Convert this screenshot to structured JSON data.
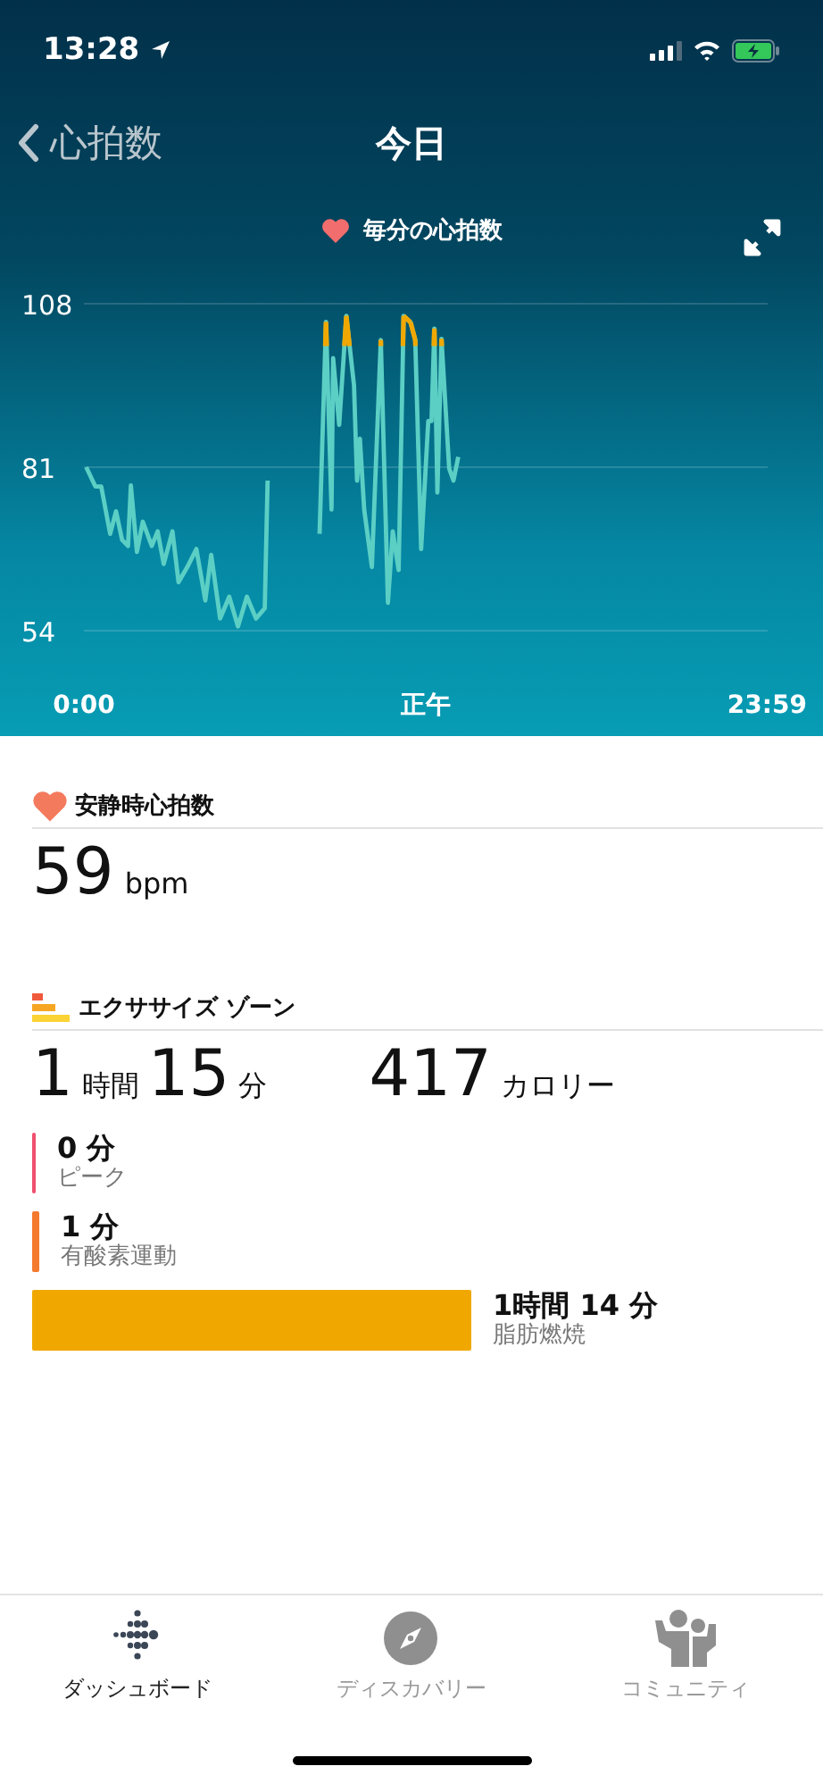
{
  "status_bar": {
    "time": "13:28"
  },
  "nav": {
    "back": "心拍数",
    "title": "今日"
  },
  "chart": {
    "title": "毎分の心拍数",
    "chart_data": {
      "type": "line",
      "x": [
        0.08,
        0.4,
        0.61,
        0.92,
        1.13,
        1.34,
        1.55,
        1.65,
        1.86,
        2.07,
        2.38,
        2.59,
        2.8,
        3.11,
        3.32,
        3.63,
        3.95,
        4.26,
        4.47,
        4.78,
        5.1,
        5.41,
        5.72,
        6.04,
        6.35,
        6.45,
        7.0,
        8.27,
        8.5,
        8.69,
        8.75,
        8.96,
        9.21,
        9.48,
        9.59,
        9.69,
        9.84,
        10.11,
        10.42,
        10.67,
        10.84,
        11.05,
        11.22,
        11.47,
        11.63,
        11.84,
        12.09,
        12.2,
        12.3,
        12.41,
        12.55,
        12.82,
        12.97,
        13.14
      ],
      "series": [
        {
          "color": "#5ccfc5",
          "values": [
            81,
            77.8,
            77.8,
            70,
            73.7,
            69,
            68,
            78,
            67,
            72,
            68,
            70.4,
            65,
            70.4,
            62,
            64.5,
            67.5,
            59,
            66.5,
            56,
            59.6,
            54.7,
            59.6,
            56,
            57.7,
            78.8,
            null,
            70,
            105,
            74,
            99,
            88,
            106,
            94.5,
            78.8,
            85.7,
            74,
            64.5,
            102,
            58.6,
            70.4,
            64,
            106,
            104.9,
            102,
            67.5,
            88.6,
            88.6,
            103.9,
            76.8,
            102.2,
            80.8,
            78.8,
            82.7
          ]
        }
      ],
      "xlim": [
        0,
        24
      ],
      "ylim": [
        54,
        108
      ],
      "xticks": [
        {
          "value": 0,
          "label": "0:00"
        },
        {
          "value": 12,
          "label": "正午"
        },
        {
          "value": 23.98,
          "label": "23:59"
        }
      ],
      "yticks": [
        54,
        81,
        108
      ]
    }
  },
  "resting": {
    "title": "安静時心拍数",
    "value": "59",
    "unit": "bpm"
  },
  "exercise": {
    "title": "エクササイズ ゾーン",
    "hours": "1",
    "hours_unit": "時間",
    "minutes": "15",
    "minutes_unit": "分",
    "calories": "417",
    "calories_unit": "カロリー",
    "zones": [
      {
        "time": "0 分",
        "label": "ピーク",
        "color": "#f0506e"
      },
      {
        "time": "1 分",
        "label": "有酸素運動",
        "color": "#f47a2e"
      },
      {
        "time": "1時間 14 分",
        "label": "脂肪燃焼",
        "color": "#f0a800"
      }
    ]
  },
  "tab_bar": [
    {
      "label": "ダッシュボード",
      "kind": "dashboard",
      "selected": true
    },
    {
      "label": "ディスカバリー",
      "kind": "discover",
      "selected": false
    },
    {
      "label": "コミュニティ",
      "kind": "community",
      "selected": false
    }
  ]
}
